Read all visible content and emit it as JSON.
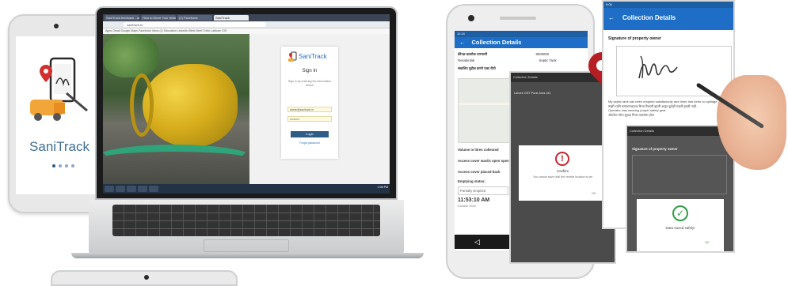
{
  "laptop": {
    "tabs": [
      "SaniTrack feedback - admin",
      "How to Move Your Network",
      "(1) Facebook",
      "SaniTrack"
    ],
    "url": "sanitrack.in",
    "bookmarks": "Apps  Gmail  Google Maps  Facebook  Inbox (1)  Education  LinkedIn  Bitrix  Meet  Trello  Latitude  GIS",
    "login": {
      "brand": "SaniTrack",
      "title": "Sign In",
      "subtitle": "Sign in by entering the information below",
      "email_value": "admin@sanitrack.in",
      "password_value": "••••••••••",
      "login_button": "Login",
      "forgot": "Forgot password"
    },
    "clock": "2:06 PM"
  },
  "left_phone": {
    "title": "SaniTrack"
  },
  "middle_phone": {
    "status": "11:14",
    "appbar_title": "Collection Details",
    "rows": [
      {
        "label": "कीनज्ञ काळोक पारमाणी",
        "value": "8005000"
      },
      {
        "label": "Residential",
        "value": "Septic Tank"
      },
      {
        "label": "संकलित पुढील करणे एका रीती",
        "value": ""
      },
      {
        "label": "Volume in litres collected",
        "value": ""
      },
      {
        "label": "Access cover was/is open open",
        "value": ""
      },
      {
        "label": "Access cover placed back",
        "value": ""
      },
      {
        "label": "Emptying status:",
        "value": ""
      },
      {
        "label": "Partially Emptied",
        "value": ""
      }
    ],
    "time": "11:53:10 AM",
    "date": "October 2019"
  },
  "popup_phone": {
    "bar": "Collection Details",
    "row": "Lahore GST Pune Area 411",
    "dialog_title": "Confirm",
    "dialog_text": "You cannot save until the vehicle location is set",
    "dialog_ok": "OK"
  },
  "right_phone": {
    "status": "9:05",
    "appbar_title": "Collection Details",
    "label": "Signature of property owner",
    "text_lines": [
      "My septic tank has been emptied satisfactorily and there has been no spillage.",
      "माझी टाकी समाधानकारक रित्या रिकामी झाली असून कुठेही गळती झाली नाही.",
      "Operator was wearing proper safety gear",
      "ऑपरेटर योग्य सुरक्षा गियर घातलेला होता"
    ]
  },
  "success_phone": {
    "bar": "Collection Details",
    "label": "Signature of property owner",
    "dialog_text": "Data saved safely!",
    "dialog_ok": "OK"
  },
  "colors": {
    "brand_blue": "#1e6ec7",
    "logo_text": "#3e6f96",
    "pin_red": "#b51e23"
  }
}
